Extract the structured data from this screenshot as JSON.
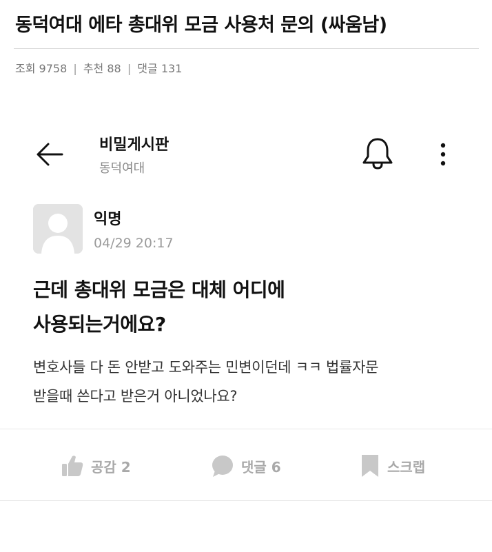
{
  "post": {
    "title": "동덕여대 에타 총대위 모금 사용처 문의 (싸움남)",
    "meta": {
      "views": "조회 9758",
      "recommends": "추천 88",
      "comments": "댓글 131",
      "separator": "|"
    }
  },
  "screenshot": {
    "header": {
      "board_name": "비밀게시판",
      "school_name": "동덕여대",
      "icons": [
        "arrow-left-icon",
        "bell-icon",
        "more-vertical-icon"
      ]
    },
    "author": {
      "name": "익명",
      "time": "04/29 20:17"
    },
    "article": {
      "title_line1": "근데 총대위 모금은 대체 어디에",
      "title_line2": "사용되는거에요?",
      "body_line1": "변호사들 다 돈 안받고 도와주는 민변이던데 ㅋㅋ 법률자문",
      "body_line2": "받을때 쓴다고 받은거 아니었나요?"
    },
    "actions": {
      "like_label": "공감 2",
      "comment_label": "댓글 6",
      "scrap_label": "스크랩"
    },
    "colors": {
      "action_gray": "#a9a9a9",
      "meta_gray": "#777777",
      "avatar_bg": "#e3e3e3"
    }
  }
}
